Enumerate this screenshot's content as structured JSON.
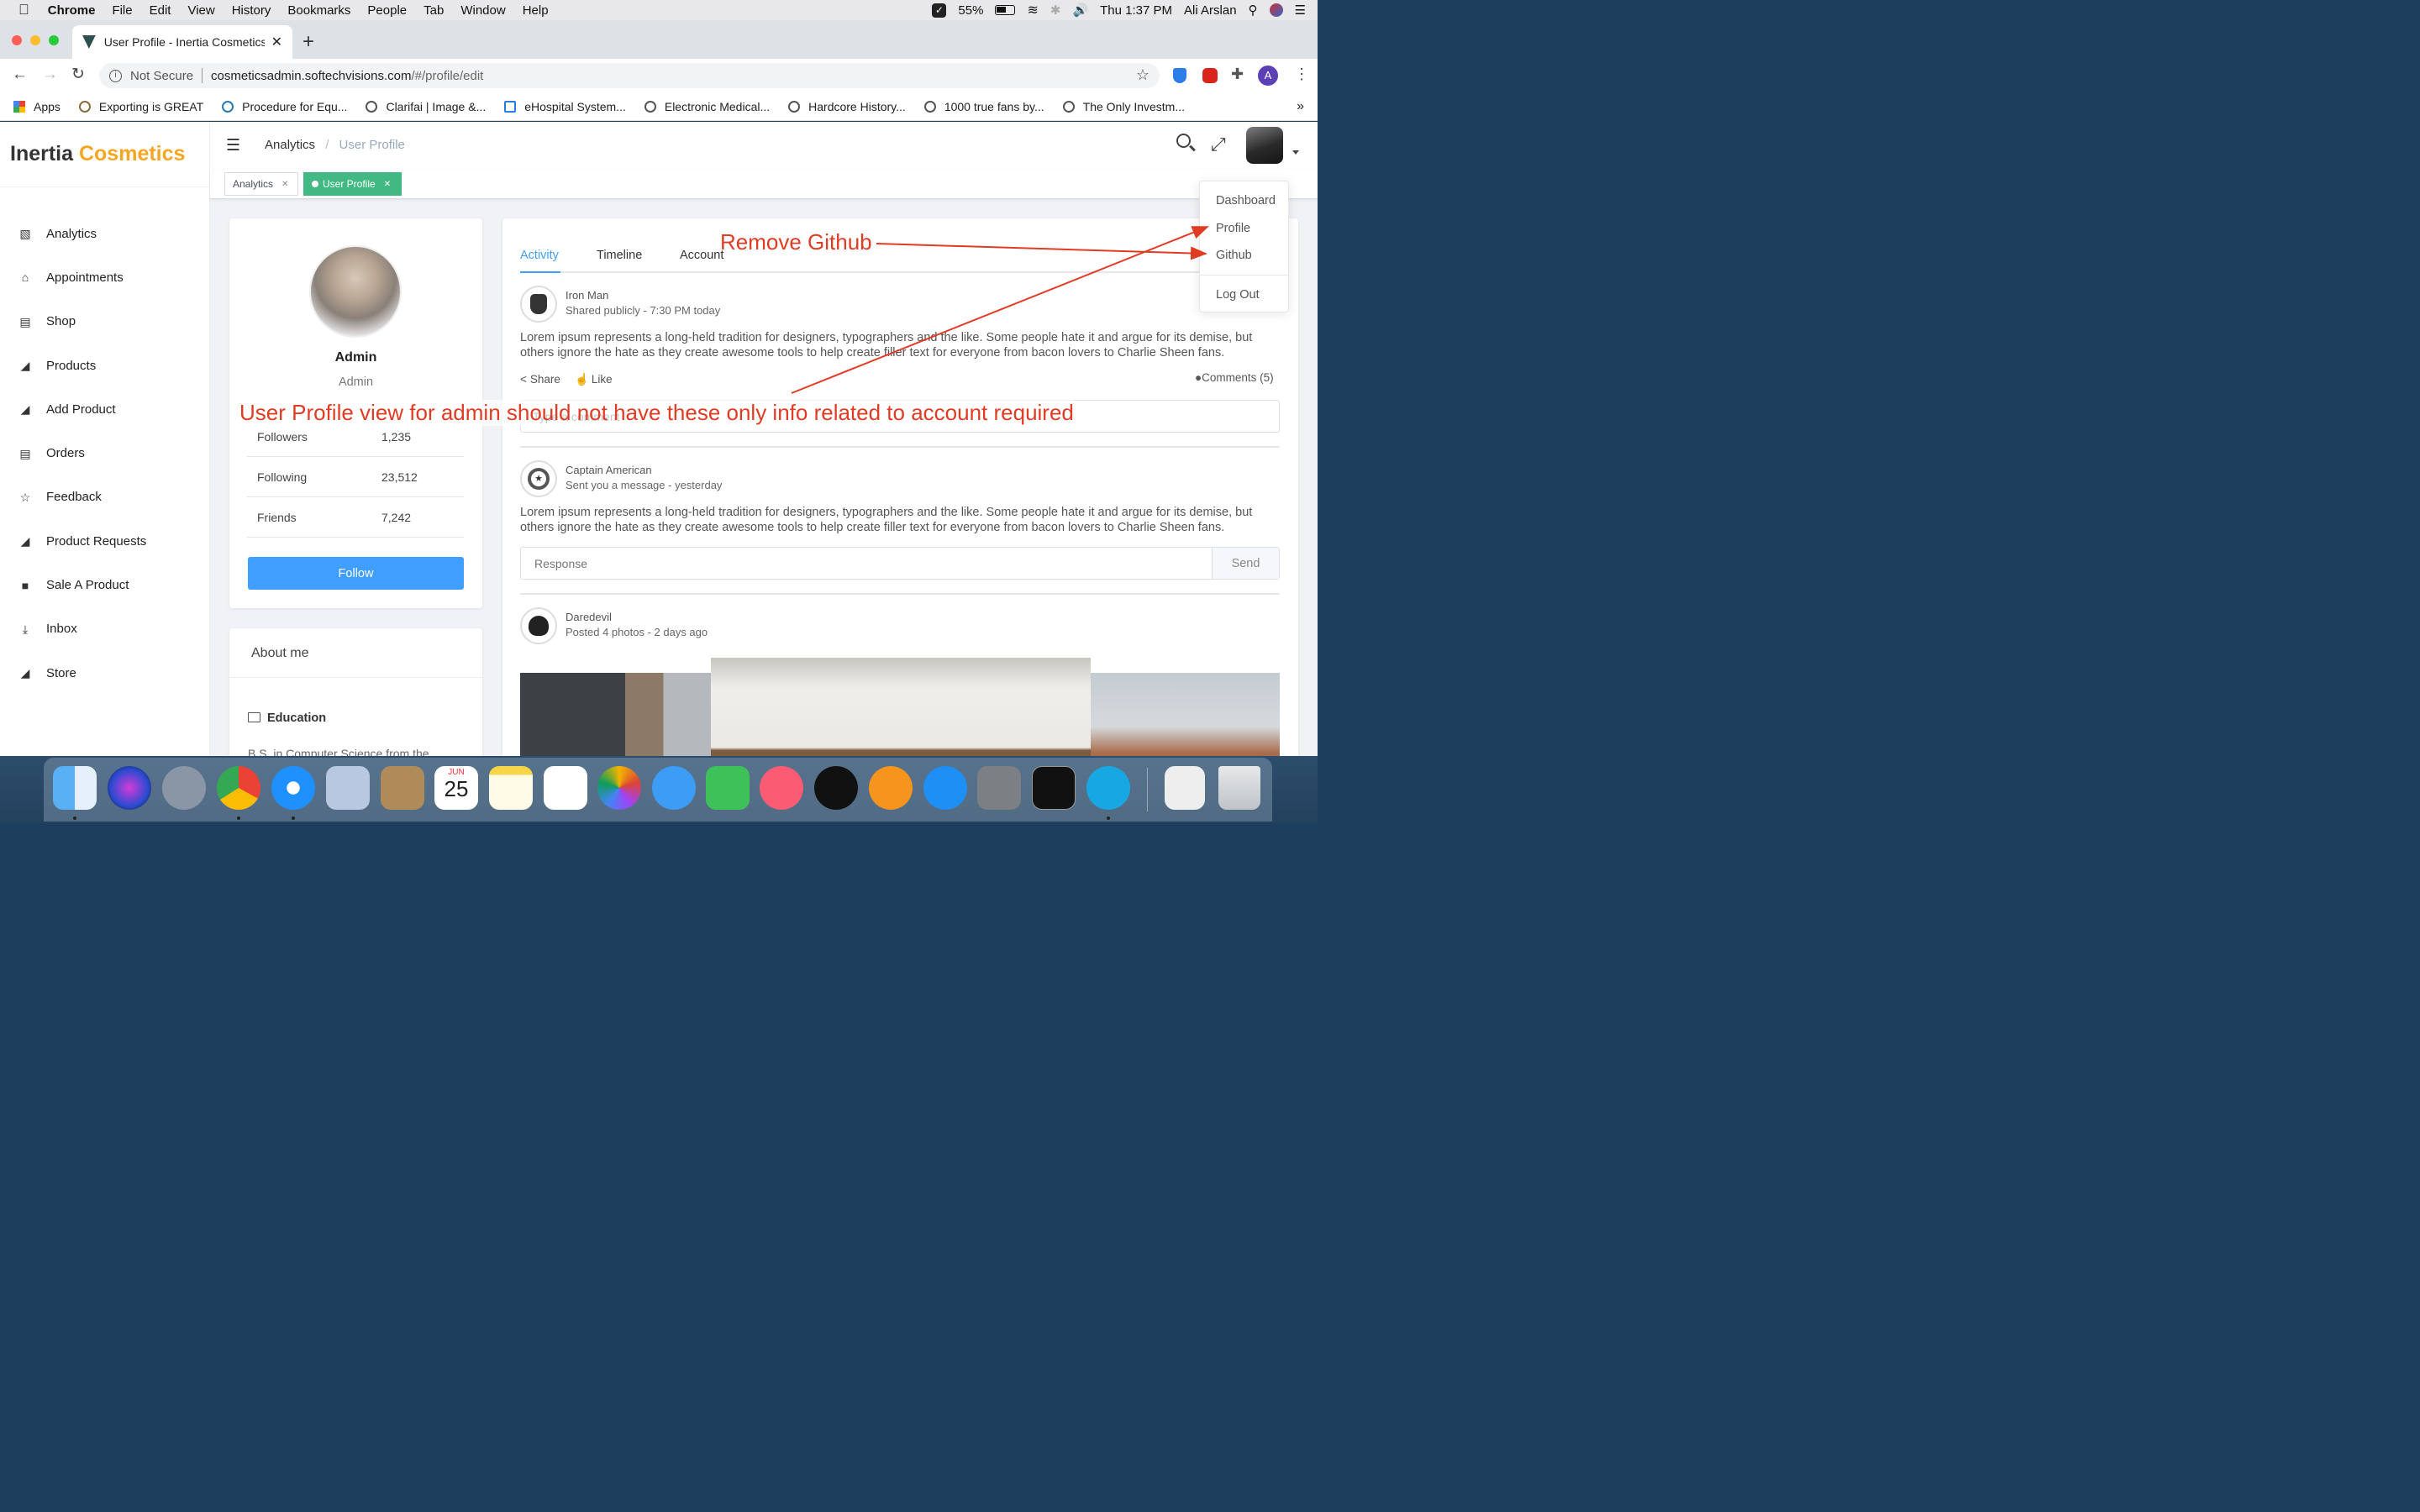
{
  "menubar": {
    "app": "Chrome",
    "items": [
      "File",
      "Edit",
      "View",
      "History",
      "Bookmarks",
      "People",
      "Tab",
      "Window",
      "Help"
    ],
    "battery": "55%",
    "clock": "Thu 1:37 PM",
    "user": "Ali Arslan"
  },
  "browser": {
    "tab_title": "User Profile - Inertia Cosmetics",
    "security": "Not Secure",
    "url_host": "cosmeticsadmin.softechvisions.com",
    "url_path": "/#/profile/edit",
    "profile_initial": "A",
    "bookmarks": [
      "Apps",
      "Exporting is GREAT",
      "Procedure for Equ...",
      "Clarifai | Image &...",
      "eHospital System...",
      "Electronic Medical...",
      "Hardcore History...",
      "1000 true fans by...",
      "The Only Investm..."
    ]
  },
  "app": {
    "brand_left": "Inertia",
    "brand_right": "Cosmetics",
    "nav": [
      {
        "label": "Analytics",
        "icon": "chart-icon"
      },
      {
        "label": "Appointments",
        "icon": "home-icon"
      },
      {
        "label": "Shop",
        "icon": "shop-icon"
      },
      {
        "label": "Products",
        "icon": "cart-icon"
      },
      {
        "label": "Add Product",
        "icon": "cart-plus-icon"
      },
      {
        "label": "Orders",
        "icon": "list-icon"
      },
      {
        "label": "Feedback",
        "icon": "star-icon"
      },
      {
        "label": "Product Requests",
        "icon": "cart-plus-icon"
      },
      {
        "label": "Sale A Product",
        "icon": "bag-icon"
      },
      {
        "label": "Inbox",
        "icon": "download-icon"
      },
      {
        "label": "Store",
        "icon": "cart-icon"
      }
    ],
    "breadcrumb": {
      "root": "Analytics",
      "sep": "/",
      "current": "User Profile"
    },
    "tags": [
      {
        "label": "Analytics"
      },
      {
        "label": "User Profile"
      }
    ],
    "colors": {
      "accent": "#409eff",
      "tag_active": "#42b983",
      "brand_orange": "#f5a623"
    }
  },
  "profile": {
    "name": "Admin",
    "role": "Admin",
    "stats": [
      {
        "label": "Followers",
        "value": "1,235"
      },
      {
        "label": "Following",
        "value": "23,512"
      },
      {
        "label": "Friends",
        "value": "7,242"
      }
    ],
    "follow_label": "Follow",
    "about_title": "About me",
    "education_title": "Education",
    "education_text": "B.S. in Computer Science from the"
  },
  "activity": {
    "tabs": [
      "Activity",
      "Timeline",
      "Account"
    ],
    "posts": [
      {
        "author": "Iron Man",
        "meta": "Shared publicly - 7:30 PM today",
        "text": "Lorem ipsum represents a long-held tradition for designers, typographers and the like. Some people hate it and argue for its demise, but others ignore the hate as they create awesome tools to help create filler text for everyone from bacon lovers to Charlie Sheen fans."
      },
      {
        "author": "Captain American",
        "meta": "Sent you a message - yesterday",
        "text": "Lorem ipsum represents a long-held tradition for designers, typographers and the like. Some people hate it and argue for its demise, but others ignore the hate as they create awesome tools to help create filler text for everyone from bacon lovers to Charlie Sheen fans."
      },
      {
        "author": "Daredevil",
        "meta": "Posted 4 photos - 2 days ago"
      }
    ],
    "share_label": "Share",
    "like_label": "Like",
    "comments_label": "Comments (5)",
    "comment_placeholder": "Type a comment",
    "response_placeholder": "Response",
    "send_label": "Send"
  },
  "dropdown": [
    "Dashboard",
    "Profile",
    "Github",
    "Log Out"
  ],
  "annotations": {
    "remove_github": "Remove Github",
    "note": "User Profile view for admin should not have these only info related to account required"
  },
  "dock": {
    "calendar_month": "JUN",
    "calendar_day": "25"
  }
}
